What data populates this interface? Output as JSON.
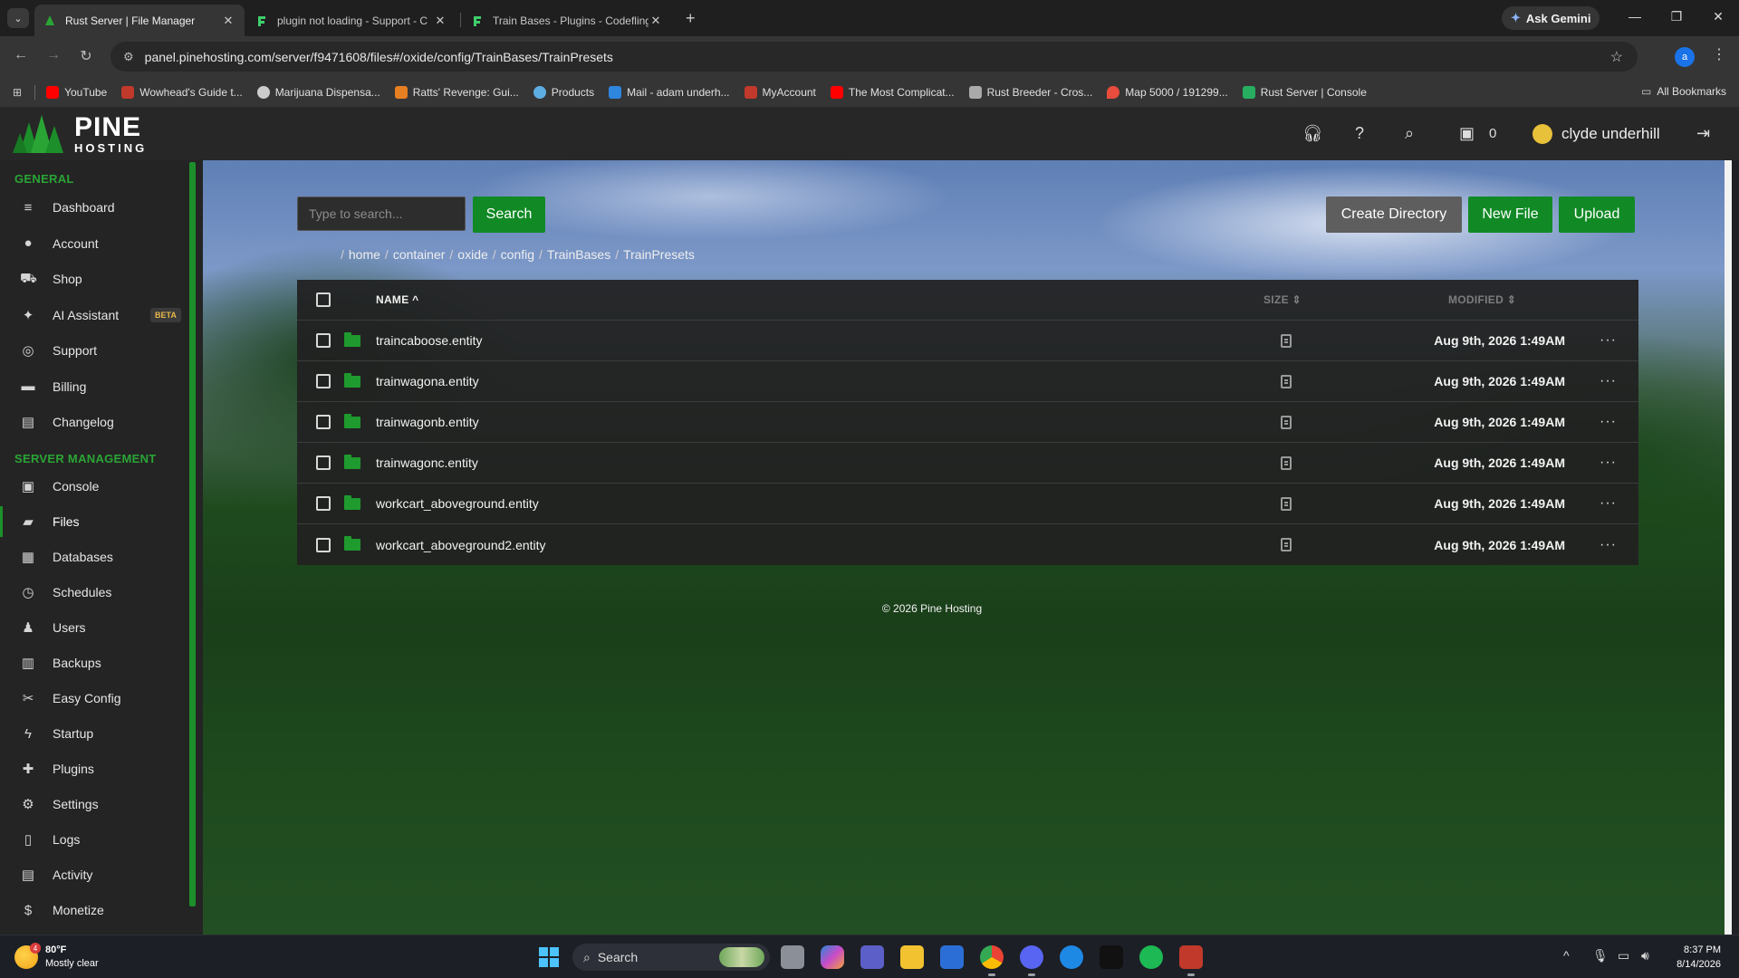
{
  "browser": {
    "tabs": [
      {
        "title": "Rust Server | File Manager",
        "active": true
      },
      {
        "title": "plugin not loading - Support - C",
        "active": false
      },
      {
        "title": "Train Bases - Plugins - Codefling",
        "active": false
      }
    ],
    "ask_gemini": "Ask Gemini",
    "url": "panel.pinehosting.com/server/f9471608/files#/oxide/config/TrainBases/TrainPresets",
    "profile_initial": "a",
    "bookmarks": [
      {
        "label": "YouTube",
        "color": "#ff0000"
      },
      {
        "label": "Wowhead's Guide t...",
        "color": "#c0392b"
      },
      {
        "label": "Marijuana Dispensa...",
        "color": "#cccccc"
      },
      {
        "label": "Ratts' Revenge: Gui...",
        "color": "#e67e22"
      },
      {
        "label": "Products",
        "color": "#5dade2"
      },
      {
        "label": "Mail - adam underh...",
        "color": "#2e86de"
      },
      {
        "label": "MyAccount",
        "color": "#c0392b"
      },
      {
        "label": "The Most Complicat...",
        "color": "#ff0000"
      },
      {
        "label": "Rust Breeder - Cros...",
        "color": "#aaaaaa"
      },
      {
        "label": "Map 5000 / 191299...",
        "color": "#e74c3c"
      },
      {
        "label": "Rust Server | Console",
        "color": "#27ae60"
      }
    ],
    "all_bookmarks": "All Bookmarks"
  },
  "panel": {
    "logo_main": "PINE",
    "logo_sub": "HOSTING",
    "notification_count": "0",
    "username": "clyde underhill"
  },
  "sidebar": {
    "general_title": "GENERAL",
    "general": [
      {
        "label": "Dashboard",
        "icon": "≡"
      },
      {
        "label": "Account",
        "icon": "●"
      },
      {
        "label": "Shop",
        "icon": "⛟"
      },
      {
        "label": "AI Assistant",
        "icon": "✦",
        "badge": "BETA"
      },
      {
        "label": "Support",
        "icon": "◎"
      },
      {
        "label": "Billing",
        "icon": "▬"
      },
      {
        "label": "Changelog",
        "icon": "▤"
      }
    ],
    "server_title": "SERVER MANAGEMENT",
    "server": [
      {
        "label": "Console",
        "icon": "▣"
      },
      {
        "label": "Files",
        "icon": "▰",
        "active": true
      },
      {
        "label": "Databases",
        "icon": "▦"
      },
      {
        "label": "Schedules",
        "icon": "◷"
      },
      {
        "label": "Users",
        "icon": "♟"
      },
      {
        "label": "Backups",
        "icon": "▥"
      },
      {
        "label": "Easy Config",
        "icon": "✂"
      },
      {
        "label": "Startup",
        "icon": "ϟ"
      },
      {
        "label": "Plugins",
        "icon": "✚"
      },
      {
        "label": "Settings",
        "icon": "⚙"
      },
      {
        "label": "Logs",
        "icon": "▯"
      },
      {
        "label": "Activity",
        "icon": "▤"
      },
      {
        "label": "Monetize",
        "icon": "$"
      }
    ]
  },
  "files": {
    "search_placeholder": "Type to search...",
    "search_button": "Search",
    "create_directory": "Create Directory",
    "new_file": "New File",
    "upload": "Upload",
    "breadcrumb": [
      "home",
      "container",
      "oxide",
      "config",
      "TrainBases",
      "TrainPresets"
    ],
    "columns": {
      "name": "NAME ^",
      "size": "SIZE ⇕",
      "modified": "MODIFIED ⇕"
    },
    "rows": [
      {
        "name": "traincaboose.entity",
        "modified": "Aug 9th, 2026 1:49AM"
      },
      {
        "name": "trainwagona.entity",
        "modified": "Aug 9th, 2026 1:49AM"
      },
      {
        "name": "trainwagonb.entity",
        "modified": "Aug 9th, 2026 1:49AM"
      },
      {
        "name": "trainwagonc.entity",
        "modified": "Aug 9th, 2026 1:49AM"
      },
      {
        "name": "workcart_aboveground.entity",
        "modified": "Aug 9th, 2026 1:49AM"
      },
      {
        "name": "workcart_aboveground2.entity",
        "modified": "Aug 9th, 2026 1:49AM"
      }
    ],
    "footer": "© 2026 Pine Hosting"
  },
  "taskbar": {
    "temp": "80°F",
    "weather": "Mostly clear",
    "weather_badge": "4",
    "search": "Search",
    "time": "8:37 PM",
    "date": "8/14/2026"
  }
}
